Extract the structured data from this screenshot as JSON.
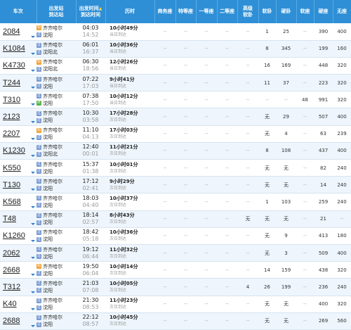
{
  "headers": {
    "train": "车次",
    "station_top": "出发站",
    "station_bottom": "到达站",
    "time_top": "出发时间",
    "time_bottom": "到达时间",
    "duration": "历时",
    "business": "商务座",
    "first_special": "特等座",
    "first": "一等座",
    "second": "二等座",
    "soft_deluxe_top": "高级",
    "soft_deluxe_bottom": "软卧",
    "soft_sleeper": "软卧",
    "hard_sleeper": "硬卧",
    "soft_seat": "软座",
    "hard_seat": "硬座",
    "no_seat": "无座",
    "sort_arrow": "▲"
  },
  "icon_labels": {
    "origin": "始",
    "pass": "过",
    "terminal": "终"
  },
  "rows": [
    {
      "train": "2084",
      "from": "齐齐哈尔",
      "to": "沈阳",
      "dep": "04:03",
      "arr": "14:52",
      "dur": "10小时49分",
      "day": "当日到达",
      "fi": "shi",
      "ti": "guo",
      "seats": [
        "--",
        "--",
        "--",
        "--",
        "--",
        "1",
        "25",
        "--",
        "390",
        "400"
      ]
    },
    {
      "train": "K1084",
      "from": "齐齐哈尔",
      "to": "沈阳北",
      "dep": "06:01",
      "arr": "16:37",
      "dur": "10小时36分",
      "day": "当日到达",
      "fi": "guo",
      "ti": "guo",
      "seats": [
        "--",
        "--",
        "--",
        "--",
        "--",
        "8",
        "345",
        "--",
        "199",
        "160"
      ]
    },
    {
      "train": "K4730",
      "from": "齐齐哈尔",
      "to": "沈阳北",
      "dep": "06:30",
      "arr": "18:56",
      "dur": "12小时26分",
      "day": "当日到达",
      "fi": "shi",
      "ti": "guo",
      "seats": [
        "--",
        "--",
        "--",
        "--",
        "--",
        "16",
        "169",
        "--",
        "448",
        "320"
      ]
    },
    {
      "train": "T244",
      "from": "齐齐哈尔",
      "to": "沈阳",
      "dep": "07:22",
      "arr": "17:03",
      "dur": "9小时41分",
      "day": "当日到达",
      "fi": "guo",
      "ti": "guo",
      "seats": [
        "--",
        "--",
        "--",
        "--",
        "--",
        "11",
        "37",
        "--",
        "223",
        "320"
      ]
    },
    {
      "train": "T310",
      "from": "齐齐哈尔",
      "to": "沈阳",
      "dep": "07:38",
      "arr": "17:50",
      "dur": "10小时12分",
      "day": "当日到达",
      "fi": "guo",
      "ti": "zhong",
      "seats": [
        "--",
        "--",
        "--",
        "--",
        "--",
        "--",
        "--",
        "48",
        "991",
        "320"
      ]
    },
    {
      "train": "2123",
      "from": "齐齐哈尔",
      "to": "沈阳",
      "dep": "10:30",
      "arr": "03:58",
      "dur": "17小时28分",
      "day": "次日到达",
      "fi": "guo",
      "ti": "guo",
      "seats": [
        "--",
        "--",
        "--",
        "--",
        "--",
        "无",
        "29",
        "--",
        "507",
        "400"
      ]
    },
    {
      "train": "2207",
      "from": "齐齐哈尔",
      "to": "沈阳",
      "dep": "11:10",
      "arr": "04:13",
      "dur": "17小时03分",
      "day": "次日到达",
      "fi": "shi",
      "ti": "guo",
      "seats": [
        "--",
        "--",
        "--",
        "--",
        "--",
        "无",
        "4",
        "--",
        "63",
        "239"
      ]
    },
    {
      "train": "K1230",
      "from": "齐齐哈尔",
      "to": "沈阳北",
      "dep": "12:40",
      "arr": "00:01",
      "dur": "11小时21分",
      "day": "次日到达",
      "fi": "guo",
      "ti": "guo",
      "seats": [
        "--",
        "--",
        "--",
        "--",
        "--",
        "8",
        "108",
        "--",
        "437",
        "400"
      ]
    },
    {
      "train": "K550",
      "from": "齐齐哈尔",
      "to": "沈阳",
      "dep": "15:37",
      "arr": "01:38",
      "dur": "10小时01分",
      "day": "次日到达",
      "fi": "guo",
      "ti": "guo",
      "seats": [
        "--",
        "--",
        "--",
        "--",
        "--",
        "无",
        "无",
        "--",
        "82",
        "240"
      ]
    },
    {
      "train": "T130",
      "from": "齐齐哈尔",
      "to": "沈阳",
      "dep": "17:12",
      "arr": "02:41",
      "dur": "9小时29分",
      "day": "次日到达",
      "fi": "guo",
      "ti": "guo",
      "seats": [
        "--",
        "--",
        "--",
        "--",
        "--",
        "无",
        "无",
        "--",
        "14",
        "240"
      ]
    },
    {
      "train": "K568",
      "from": "齐齐哈尔",
      "to": "沈阳",
      "dep": "18:03",
      "arr": "04:40",
      "dur": "10小时37分",
      "day": "次日到达",
      "fi": "guo",
      "ti": "guo",
      "seats": [
        "--",
        "--",
        "--",
        "--",
        "--",
        "1",
        "103",
        "--",
        "259",
        "240"
      ]
    },
    {
      "train": "T48",
      "from": "齐齐哈尔",
      "to": "沈阳",
      "dep": "18:14",
      "arr": "02:57",
      "dur": "8小时43分",
      "day": "次日到达",
      "fi": "guo",
      "ti": "guo",
      "seats": [
        "--",
        "--",
        "--",
        "--",
        "无",
        "无",
        "无",
        "--",
        "21",
        "--"
      ]
    },
    {
      "train": "K1260",
      "from": "齐齐哈尔",
      "to": "沈阳",
      "dep": "18:42",
      "arr": "05:18",
      "dur": "10小时36分",
      "day": "次日到达",
      "fi": "guo",
      "ti": "guo",
      "seats": [
        "--",
        "--",
        "--",
        "--",
        "--",
        "无",
        "9",
        "--",
        "413",
        "180"
      ]
    },
    {
      "train": "2062",
      "from": "齐齐哈尔",
      "to": "沈阳",
      "dep": "19:12",
      "arr": "06:44",
      "dur": "11小时32分",
      "day": "次日到达",
      "fi": "guo",
      "ti": "guo",
      "seats": [
        "--",
        "--",
        "--",
        "--",
        "--",
        "无",
        "3",
        "--",
        "509",
        "400"
      ]
    },
    {
      "train": "2668",
      "from": "齐齐哈尔",
      "to": "沈阳",
      "dep": "19:50",
      "arr": "06:04",
      "dur": "10小时14分",
      "day": "次日到达",
      "fi": "shi",
      "ti": "guo",
      "seats": [
        "--",
        "--",
        "--",
        "--",
        "--",
        "14",
        "159",
        "--",
        "438",
        "320"
      ]
    },
    {
      "train": "T312",
      "from": "齐齐哈尔",
      "to": "沈阳",
      "dep": "21:03",
      "arr": "07:08",
      "dur": "10小时05分",
      "day": "次日到达",
      "fi": "guo",
      "ti": "guo",
      "seats": [
        "--",
        "--",
        "--",
        "--",
        "4",
        "26",
        "199",
        "--",
        "236",
        "240"
      ]
    },
    {
      "train": "K40",
      "from": "齐齐哈尔",
      "to": "沈阳",
      "dep": "21:30",
      "arr": "08:53",
      "dur": "11小时23分",
      "day": "次日到达",
      "fi": "guo",
      "ti": "guo",
      "seats": [
        "--",
        "--",
        "--",
        "--",
        "--",
        "无",
        "无",
        "--",
        "400",
        "320"
      ]
    },
    {
      "train": "2688",
      "from": "齐齐哈尔",
      "to": "沈阳",
      "dep": "22:12",
      "arr": "08:57",
      "dur": "10小时45分",
      "day": "次日到达",
      "fi": "guo",
      "ti": "guo",
      "seats": [
        "--",
        "--",
        "--",
        "--",
        "--",
        "无",
        "无",
        "--",
        "269",
        "560"
      ]
    }
  ]
}
